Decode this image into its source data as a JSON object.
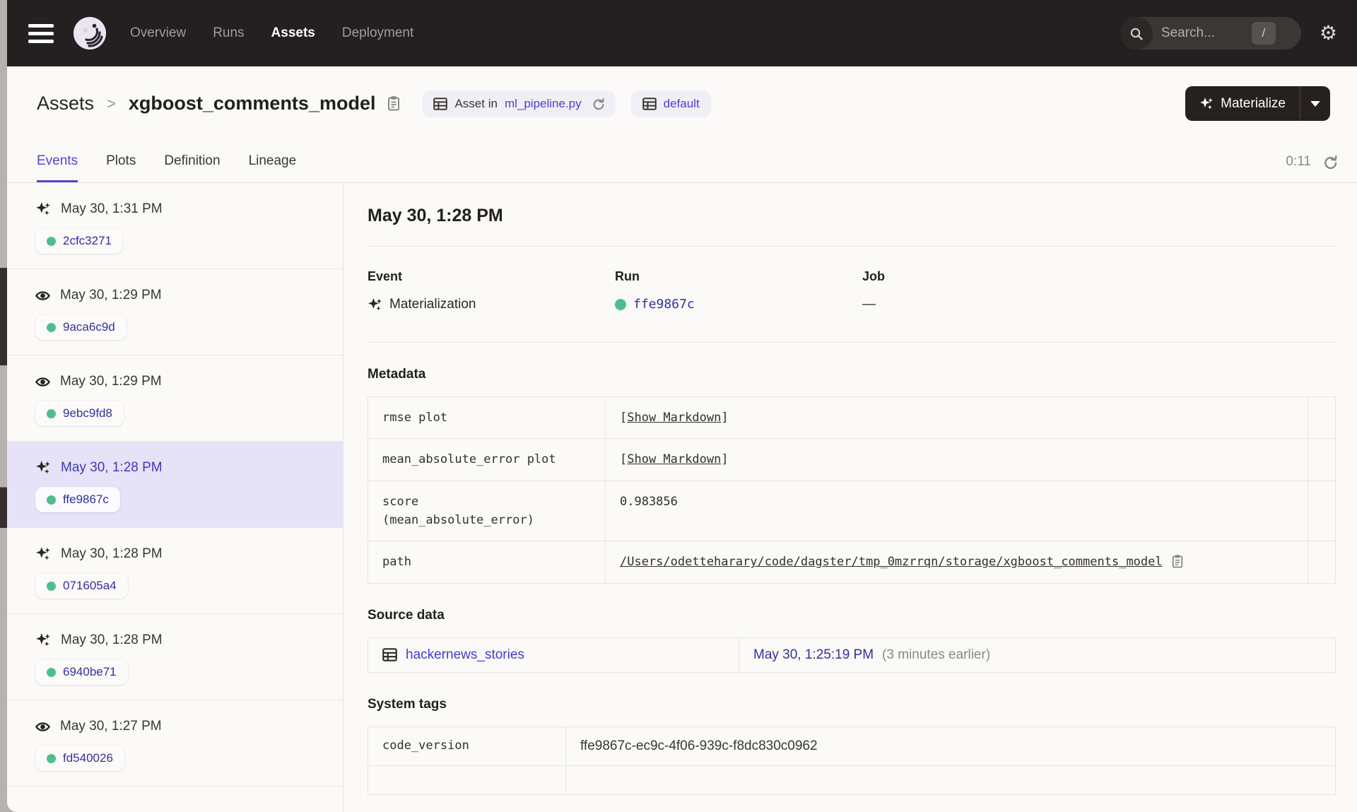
{
  "colors": {
    "topbar_bg": "#241f20",
    "accent_indigo": "#5146d2",
    "link_indigo": "#3f3bd6",
    "run_id_navy": "#34309b",
    "status_green": "#4fbe8d",
    "selected_lavender": "#e6e2f7",
    "page_bg": "#fbfaf8"
  },
  "topnav": {
    "items": [
      {
        "label": "Overview",
        "active": false
      },
      {
        "label": "Runs",
        "active": false
      },
      {
        "label": "Assets",
        "active": true
      },
      {
        "label": "Deployment",
        "active": false
      }
    ],
    "search": {
      "placeholder": "Search...",
      "shortcut": "/"
    }
  },
  "header": {
    "breadcrumb_root": "Assets",
    "breadcrumb_separator": ">",
    "asset_name": "xgboost_comments_model",
    "asset_badge": {
      "prefix": "Asset in",
      "link": "ml_pipeline.py"
    },
    "location_badge": {
      "link": "default"
    },
    "materialize_label": "Materialize"
  },
  "tabs": {
    "items": [
      {
        "label": "Events",
        "active": true
      },
      {
        "label": "Plots",
        "active": false
      },
      {
        "label": "Definition",
        "active": false
      },
      {
        "label": "Lineage",
        "active": false
      }
    ],
    "timer": "0:11"
  },
  "sidebar": {
    "events": [
      {
        "type": "materialization",
        "timestamp": "May 30, 1:31 PM",
        "run_id": "2cfc3271",
        "selected": false
      },
      {
        "type": "observation",
        "timestamp": "May 30, 1:29 PM",
        "run_id": "9aca6c9d",
        "selected": false
      },
      {
        "type": "observation",
        "timestamp": "May 30, 1:29 PM",
        "run_id": "9ebc9fd8",
        "selected": false
      },
      {
        "type": "materialization",
        "timestamp": "May 30, 1:28 PM",
        "run_id": "ffe9867c",
        "selected": true
      },
      {
        "type": "materialization",
        "timestamp": "May 30, 1:28 PM",
        "run_id": "071605a4",
        "selected": false
      },
      {
        "type": "materialization",
        "timestamp": "May 30, 1:28 PM",
        "run_id": "6940be71",
        "selected": false
      },
      {
        "type": "observation",
        "timestamp": "May 30, 1:27 PM",
        "run_id": "fd540026",
        "selected": false
      }
    ]
  },
  "detail": {
    "title": "May 30, 1:28 PM",
    "event": {
      "label": "Event",
      "value": "Materialization"
    },
    "run": {
      "label": "Run",
      "value": "ffe9867c"
    },
    "job": {
      "label": "Job",
      "value": "—"
    },
    "metadata": {
      "heading": "Metadata",
      "rows": [
        {
          "key": "rmse plot",
          "kind": "markdown",
          "open": "[",
          "link": "Show Markdown",
          "close": "]"
        },
        {
          "key": "mean_absolute_error plot",
          "kind": "markdown",
          "open": "[",
          "link": "Show Markdown",
          "close": "]"
        },
        {
          "key": "score\n(mean_absolute_error)",
          "kind": "text",
          "value": "0.983856"
        },
        {
          "key": "path",
          "kind": "path",
          "value": "/Users/odetteharary/code/dagster/tmp_0mzrrqn/storage/xgboost_comments_model"
        }
      ]
    },
    "source_data": {
      "heading": "Source data",
      "asset": "hackernews_stories",
      "timestamp": "May 30, 1:25:19 PM",
      "relative": "(3 minutes earlier)"
    },
    "system_tags": {
      "heading": "System tags",
      "rows": [
        {
          "key": "code_version",
          "value": "ffe9867c-ec9c-4f06-939c-f8dc830c0962"
        }
      ]
    }
  }
}
